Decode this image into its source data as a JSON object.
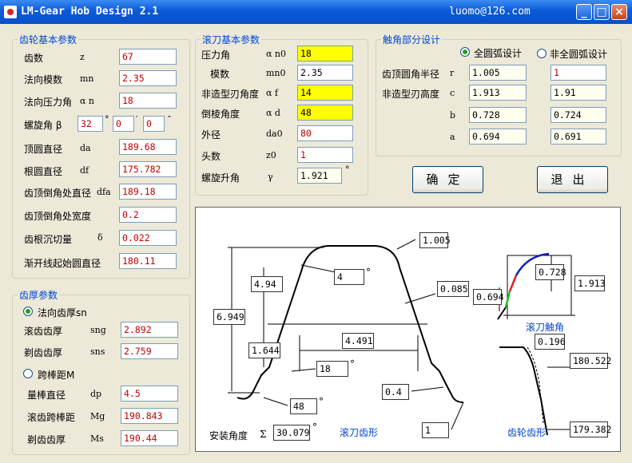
{
  "window": {
    "title": "LM-Gear Hob Design 2.1",
    "email": "luomo@126.com",
    "minimize_glyph": "_",
    "maximize_glyph": "□",
    "close_glyph": "×"
  },
  "gear": {
    "legend": "齿轮基本参数",
    "rows": [
      {
        "label": "齿数",
        "sym": "z",
        "value": "67"
      },
      {
        "label": "法向模数",
        "sym": "mn",
        "value": "2.35"
      },
      {
        "label": "法向压力角",
        "sym": "α n",
        "value": "18"
      },
      {
        "label": "顶圆直径",
        "sym": "da",
        "value": "189.68"
      },
      {
        "label": "根圆直径",
        "sym": "df",
        "value": "175.782"
      },
      {
        "label": "齿顶倒角处直径",
        "sym": "dfa",
        "value": "189.18"
      },
      {
        "label": "齿顶倒角处宽度",
        "sym": "",
        "value": "0.2"
      },
      {
        "label": "齿根沉切量",
        "sym": "δ",
        "value": "0.022"
      },
      {
        "label": "渐开线起始圆直径",
        "sym": "",
        "value": "180.11"
      }
    ],
    "helix": {
      "label": "螺旋角 β",
      "deg": "32",
      "min": "0",
      "sec": "0",
      "deg_mark": "°",
      "min_mark": "′",
      "sec_mark": "″"
    }
  },
  "thickness": {
    "legend": "齿厚参数",
    "opt1": "法向齿厚sn",
    "opt2": "跨棒距M",
    "rows1": [
      {
        "label": "滚齿齿厚",
        "sym": "sng",
        "value": "2.892"
      },
      {
        "label": "剃齿齿厚",
        "sym": "sns",
        "value": "2.759"
      }
    ],
    "rows2": [
      {
        "label": "量棒直径",
        "sym": "dp",
        "value": "4.5"
      },
      {
        "label": "滚齿跨棒距",
        "sym": "Mg",
        "value": "190.843"
      },
      {
        "label": "剃齿齿厚",
        "sym": "Ms",
        "value": "190.44"
      }
    ]
  },
  "hob": {
    "legend": "滚刀基本参数",
    "rows": [
      {
        "label": "压力角",
        "sym": "α n0",
        "value": "18"
      },
      {
        "label": "模数",
        "sym": "mn0",
        "value": "2.35"
      },
      {
        "label": "非造型刃角度",
        "sym": "α f",
        "value": "14"
      },
      {
        "label": "倒棱角度",
        "sym": "α d",
        "value": "48"
      },
      {
        "label": "外径",
        "sym": "da0",
        "value": "80"
      },
      {
        "label": "头数",
        "sym": "z0",
        "value": "1"
      },
      {
        "label": "螺旋升角",
        "sym": "γ",
        "value": "1.921"
      }
    ],
    "deg_mark": "°"
  },
  "tip": {
    "legend": "触角部分设计",
    "opt1": "全圆弧设计",
    "opt2": "非全圆弧设计",
    "rows": [
      {
        "label": "齿顶圆角半径",
        "sym": "r",
        "v1": "1.005",
        "v2": "1"
      },
      {
        "label": "非造型刃高度",
        "sym": "c",
        "v1": "1.913",
        "v2": "1.91"
      },
      {
        "label": "",
        "sym": "b",
        "v1": "0.728",
        "v2": "0.724"
      },
      {
        "label": "",
        "sym": "a",
        "v1": "0.694",
        "v2": "0.691"
      }
    ]
  },
  "buttons": {
    "ok": "确定",
    "exit": "退出"
  },
  "drawing": {
    "hob_profile_label": "滚刀齿形",
    "gear_profile_label": "齿轮齿形",
    "hob_tip_label": "滚刀触角",
    "install_angle_label": "安装角度",
    "install_sym": "Σ",
    "install_value": "30.079",
    "deg_mark": "°",
    "dims": {
      "tip_radius": "1.005",
      "tip_angle": "4",
      "upper_height": "4.94",
      "total_height": "6.949",
      "lower_height": "1.644",
      "width": "4.491",
      "root_angle": "18",
      "chamfer_angle": "48",
      "chamfer_085": "0.085",
      "chamfer_04": "0.4",
      "bottom_1": "1",
      "tip_b": "0.728",
      "tip_a": "0.694",
      "tip_c": "1.913",
      "gear_0196": "0.196",
      "gear_d1": "180.522",
      "gear_d2": "179.382"
    }
  },
  "colors": {
    "titlebar": "#0A5AD8",
    "legend_text": "#0046D5",
    "highlight": "#FFFF00",
    "value_red": "#C00000",
    "curve_blue": "#1020C0",
    "curve_red": "#E02020",
    "curve_green": "#20C020"
  }
}
